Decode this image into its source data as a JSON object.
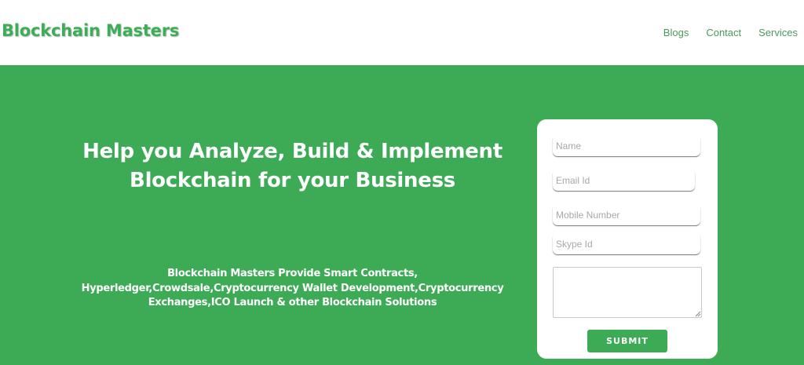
{
  "header": {
    "logo": "Blockchain Masters",
    "nav": [
      "Blogs",
      "Contact",
      "Services"
    ]
  },
  "hero": {
    "headline_lines": [
      "Help you Analyze, Build & Implement",
      "Blockchain for your Business"
    ],
    "subtext_lines": [
      "Blockchain Masters Provide Smart Contracts,",
      "Hyperledger,Crowdsale,Cryptocurrency Wallet Development,Cryptocurrency",
      "Exchanges,ICO Launch & other Blockchain Solutions"
    ]
  },
  "form": {
    "name_placeholder": "Name",
    "email_placeholder": "Email Id",
    "mobile_placeholder": "Mobile Number",
    "skype_placeholder": "Skype Id",
    "message_value": "",
    "submit_label": "SUBMIT"
  },
  "colors": {
    "brand_green": "#3dab56",
    "logo_green": "#3dae57",
    "nav_text": "#4a9a5d",
    "white": "#ffffff"
  }
}
